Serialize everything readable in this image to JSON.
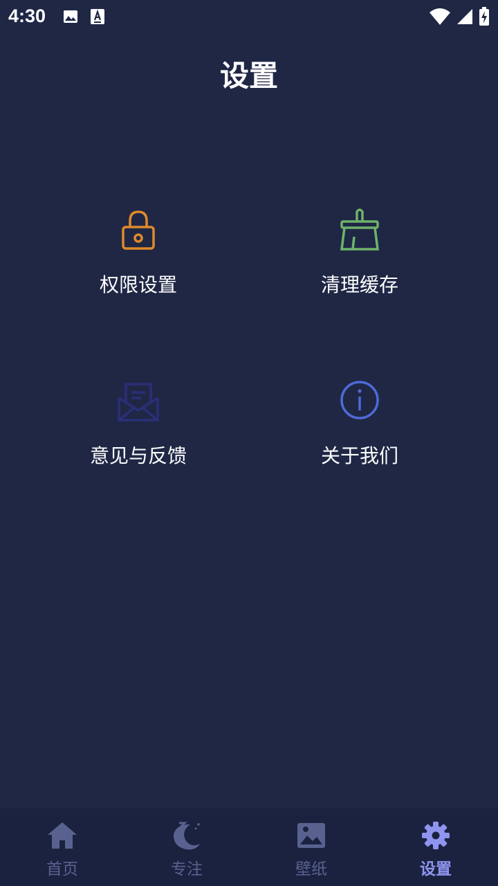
{
  "status_bar": {
    "time": "4:30"
  },
  "page": {
    "title": "设置"
  },
  "settings_items": [
    {
      "label": "权限设置",
      "icon": "lock-icon",
      "color": "#e08a2a"
    },
    {
      "label": "清理缓存",
      "icon": "broom-icon",
      "color": "#6fb36a"
    },
    {
      "label": "意见与反馈",
      "icon": "mail-open-icon",
      "color": "#2a2f78"
    },
    {
      "label": "关于我们",
      "icon": "info-icon",
      "color": "#4e6bd6"
    }
  ],
  "bottom_nav": {
    "items": [
      {
        "label": "首页",
        "icon": "home-icon"
      },
      {
        "label": "专注",
        "icon": "moon-icon"
      },
      {
        "label": "壁纸",
        "icon": "image-icon"
      },
      {
        "label": "设置",
        "icon": "gear-icon",
        "active": true
      }
    ],
    "colors": {
      "inactive": "#59628f",
      "active": "#8f95ef"
    }
  }
}
